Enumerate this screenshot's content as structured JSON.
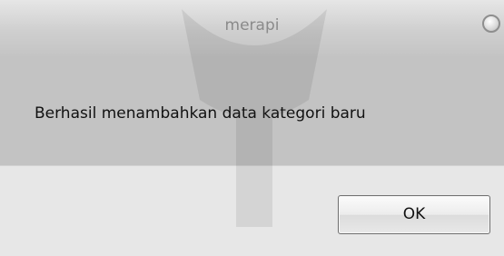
{
  "window": {
    "title": "merapi"
  },
  "message": {
    "text": "Berhasil menambahkan data kategori baru"
  },
  "buttons": {
    "ok_label": "OK"
  },
  "icons": {
    "close": "close-icon"
  },
  "colors": {
    "titlebar": "#cfcfcf",
    "content": "#c3c3c3",
    "footer": "#e7e7e7"
  }
}
